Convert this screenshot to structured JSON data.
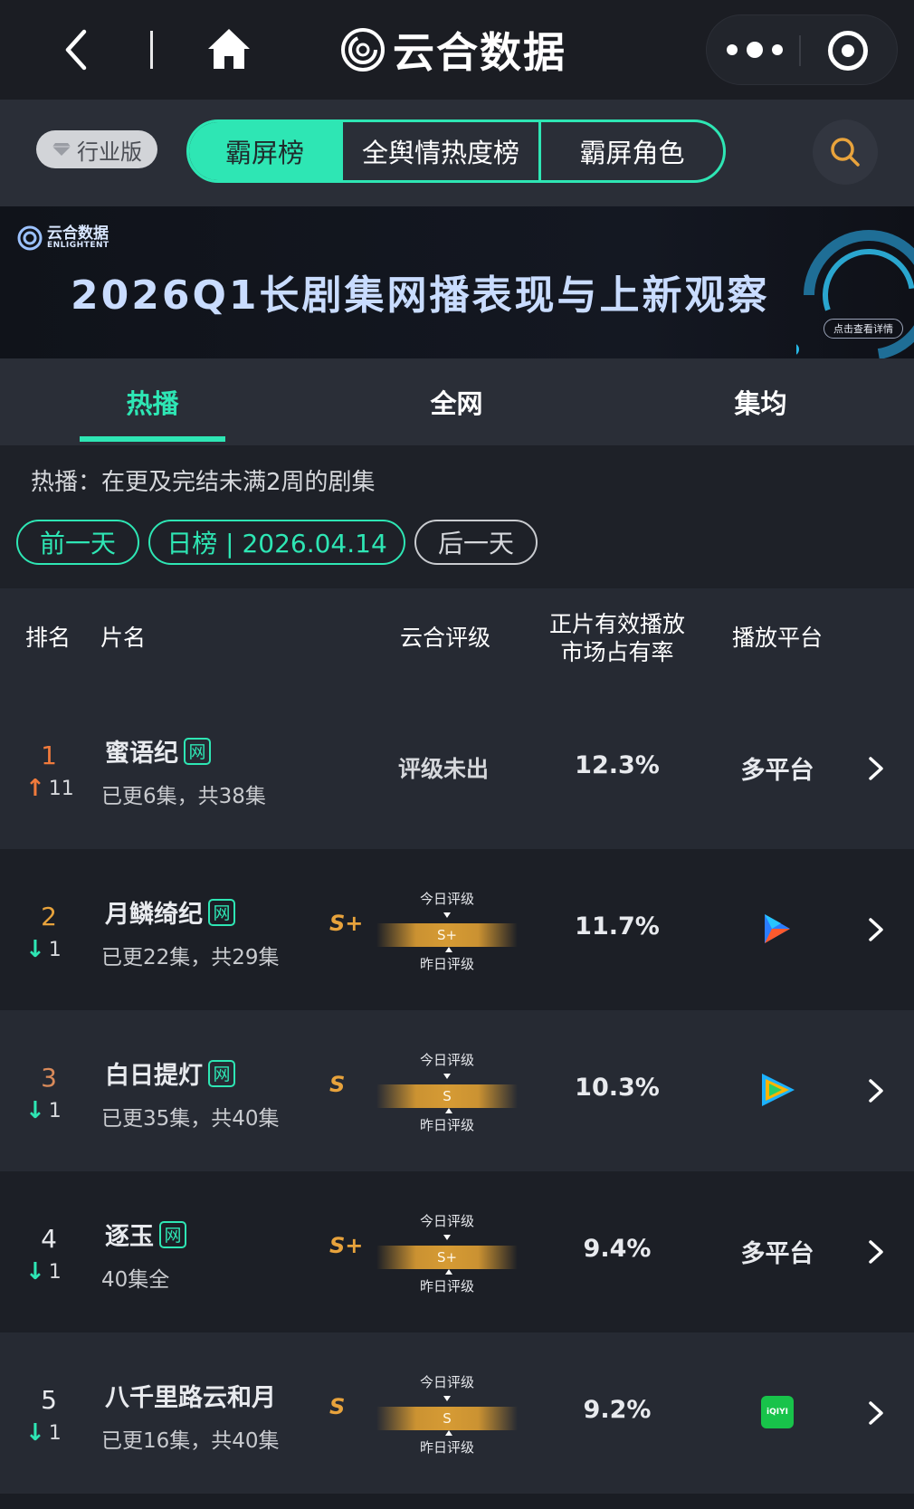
{
  "titlebar": {
    "app_title": "云合数据"
  },
  "nav": {
    "edition_label": "行业版",
    "segments": [
      "霸屏榜",
      "全舆情热度榜",
      "霸屏角色"
    ]
  },
  "banner": {
    "brand_cn": "云合数据",
    "brand_en": "ENLIGHTENT",
    "headline": "2026Q1长剧集网播表现与上新观察",
    "detail_label": "点击查看详情"
  },
  "main_tabs": [
    "热播",
    "全网",
    "集均"
  ],
  "filter": {
    "description": "热播：在更及完结未满2周的剧集",
    "prev_label": "前一天",
    "date_label": "日榜 | 2026.04.14",
    "next_label": "后一天"
  },
  "table": {
    "headers": {
      "rank": "排名",
      "title": "片名",
      "grade": "云合评级",
      "share_line1": "正片有效播放",
      "share_line2": "市场占有率",
      "platform": "播放平台"
    },
    "gauge_top_label": "今日评级",
    "gauge_bottom_label": "昨日评级",
    "web_badge": "网",
    "rows": [
      {
        "rank": "1",
        "delta": "11",
        "direction": "up",
        "title": "蜜语纪",
        "web": true,
        "episodes": "已更6集，共38集",
        "grade_text": "评级未出",
        "grade": "",
        "share": "12.3%",
        "platform": "多平台",
        "platform_icon": "",
        "rank_color": "#f07a3c"
      },
      {
        "rank": "2",
        "delta": "1",
        "direction": "down",
        "title": "月鳞绮纪",
        "web": true,
        "episodes": "已更22集，共29集",
        "grade_text": "",
        "grade": "S+",
        "share": "11.7%",
        "platform": "",
        "platform_icon": "youku-icon",
        "rank_color": "#e8a33c"
      },
      {
        "rank": "3",
        "delta": "1",
        "direction": "down",
        "title": "白日提灯",
        "web": true,
        "episodes": "已更35集，共40集",
        "grade_text": "",
        "grade": "S",
        "share": "10.3%",
        "platform": "",
        "platform_icon": "tencent-video-icon",
        "rank_color": "#d98a5a"
      },
      {
        "rank": "4",
        "delta": "1",
        "direction": "down",
        "title": "逐玉",
        "web": true,
        "episodes": "40集全",
        "grade_text": "",
        "grade": "S+",
        "share": "9.4%",
        "platform": "多平台",
        "platform_icon": "",
        "rank_color": "#e8eaee"
      },
      {
        "rank": "5",
        "delta": "1",
        "direction": "down",
        "title": "八千里路云和月",
        "web": false,
        "episodes": "已更16集，共40集",
        "grade_text": "",
        "grade": "S",
        "share": "9.2%",
        "platform": "",
        "platform_icon": "iqiyi-icon",
        "rank_color": "#e8eaee"
      }
    ]
  },
  "iqiyi_label": "iQIYI",
  "colors": {
    "accent": "#2ee6b4",
    "grade": "#e8a33c",
    "up": "#f07a3c"
  }
}
